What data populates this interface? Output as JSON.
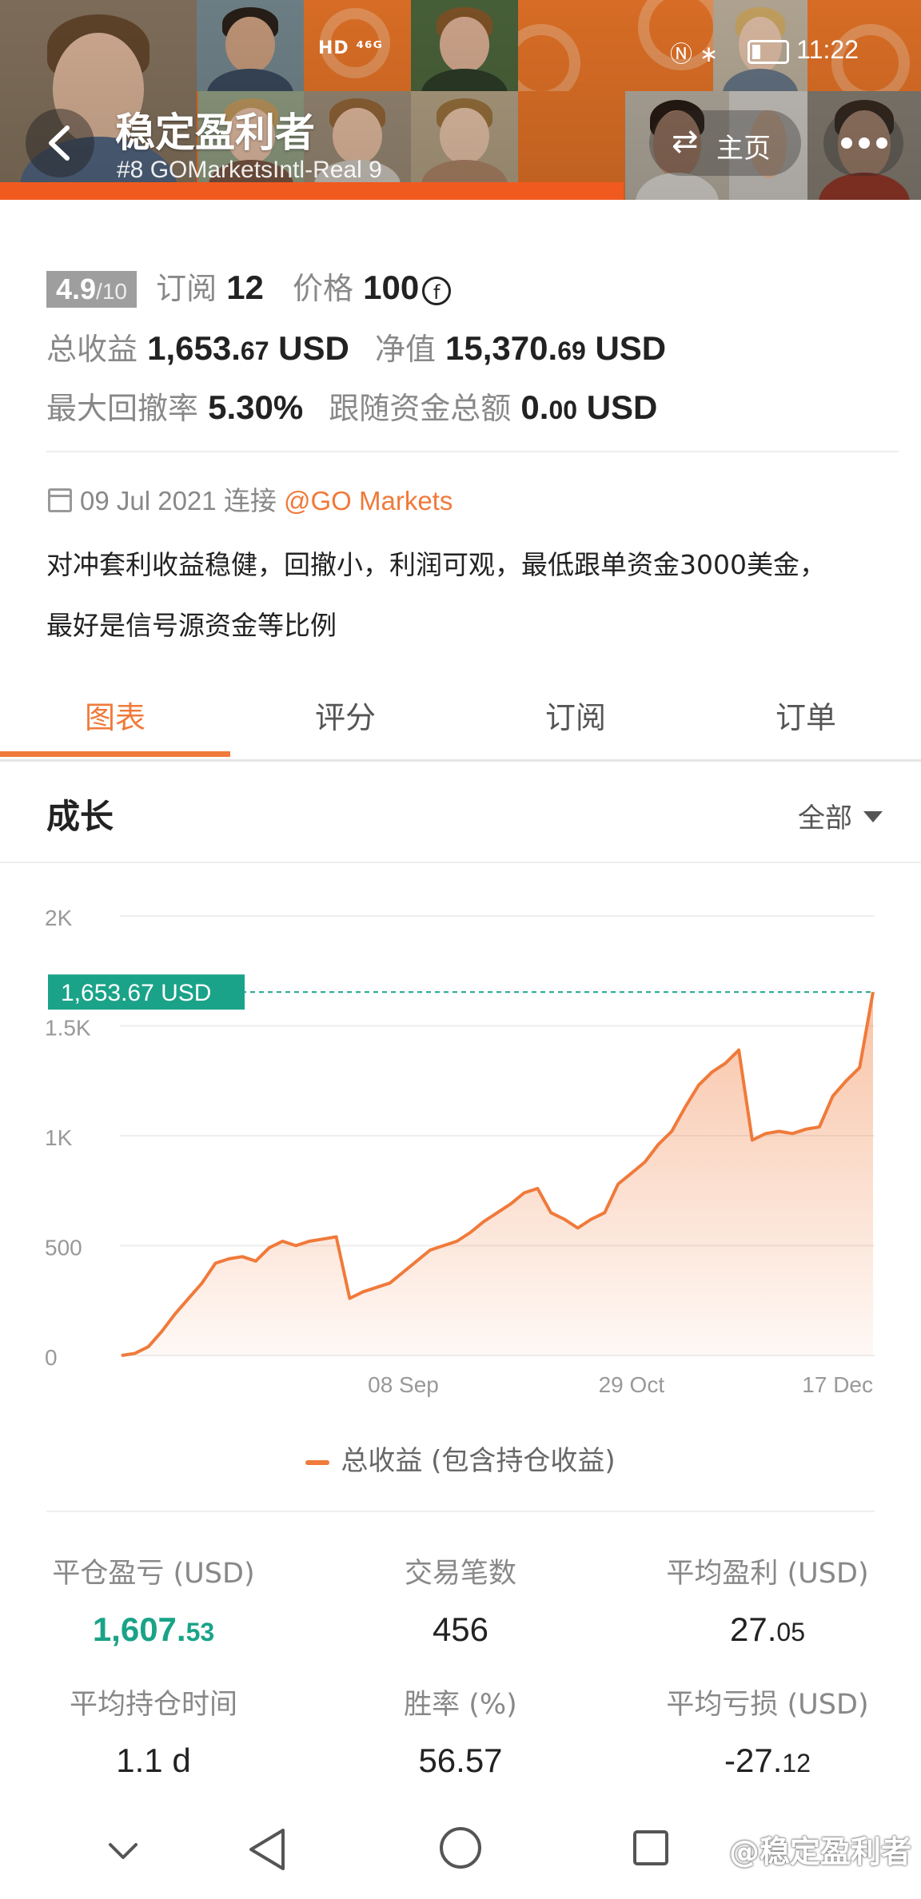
{
  "status_bar": {
    "left_icons": "HD ⁴⁶ᴳ",
    "time": "11:22"
  },
  "header": {
    "title": "稳定盈利者",
    "subtitle": "#8   GOMarketsIntl-Real 9",
    "home_label": "主页",
    "brand_color": "#f47b2a"
  },
  "stats": {
    "rating": "4.9",
    "rating_max": "/10",
    "subscribe_label": "订阅",
    "subscribe_count": "12",
    "price_label": "价格",
    "price_value": "100",
    "price_coin": "f",
    "total_profit_label": "总收益",
    "total_profit_int": "1,653.",
    "total_profit_dec": "67",
    "total_profit_unit": "USD",
    "net_value_label": "净值",
    "net_value_int": "15,370.",
    "net_value_dec": "69",
    "net_value_unit": "USD",
    "max_drawdown_label": "最大回撤率",
    "max_drawdown_value": "5.30%",
    "follow_funds_label": "跟随资金总额",
    "follow_funds_int": "0.",
    "follow_funds_dec": "00",
    "follow_funds_unit": "USD"
  },
  "info": {
    "date": "09 Jul 2021",
    "connect_label": "连接",
    "broker_link": "@GO Markets",
    "description_line1": "对冲套利收益稳健，回撤小，利润可观，最低跟单资金3000美金，",
    "description_line2": "最好是信号源资金等比例"
  },
  "tabs": [
    {
      "label": "图表",
      "active": true
    },
    {
      "label": "评分",
      "active": false
    },
    {
      "label": "订阅",
      "active": false
    },
    {
      "label": "订单",
      "active": false
    }
  ],
  "growth": {
    "title": "成长",
    "filter_label": "全部"
  },
  "chart_data": {
    "type": "area",
    "title": "",
    "xlabel": "",
    "ylabel": "",
    "x_ticks": [
      "08 Sep",
      "29 Oct",
      "17 Dec"
    ],
    "y_ticks": [
      "0",
      "500",
      "1K",
      "1.5K",
      "2K"
    ],
    "ylim": [
      0,
      2000
    ],
    "current_label": "1,653.67 USD",
    "current_value": 1653.67,
    "line_color": "#f07a3a",
    "label_color": "#1aa388",
    "legend_placement": "bottom",
    "grid": true,
    "series": [
      {
        "name": "总收益 (包含持仓收益)",
        "x": [
          "09 Jul",
          "12 Jul",
          "15 Jul",
          "18 Jul",
          "21 Jul",
          "24 Jul",
          "27 Jul",
          "30 Jul",
          "02 Aug",
          "05 Aug",
          "08 Aug",
          "11 Aug",
          "14 Aug",
          "17 Aug",
          "20 Aug",
          "23 Aug",
          "26 Aug",
          "27 Aug",
          "30 Aug",
          "02 Sep",
          "05 Sep",
          "08 Sep",
          "11 Sep",
          "14 Sep",
          "17 Sep",
          "20 Sep",
          "23 Sep",
          "26 Sep",
          "29 Sep",
          "02 Oct",
          "05 Oct",
          "08 Oct",
          "11 Oct",
          "14 Oct",
          "17 Oct",
          "20 Oct",
          "23 Oct",
          "26 Oct",
          "29 Oct",
          "01 Nov",
          "04 Nov",
          "07 Nov",
          "10 Nov",
          "13 Nov",
          "16 Nov",
          "19 Nov",
          "20 Nov",
          "23 Nov",
          "26 Nov",
          "29 Nov",
          "02 Dec",
          "05 Dec",
          "08 Dec",
          "11 Dec",
          "14 Dec",
          "15 Dec",
          "17 Dec"
        ],
        "values": [
          0,
          10,
          40,
          110,
          190,
          260,
          330,
          420,
          440,
          450,
          430,
          490,
          520,
          500,
          520,
          530,
          540,
          260,
          290,
          310,
          330,
          380,
          430,
          480,
          500,
          520,
          560,
          610,
          650,
          690,
          740,
          760,
          650,
          620,
          580,
          620,
          650,
          780,
          830,
          880,
          960,
          1020,
          1130,
          1230,
          1290,
          1330,
          1390,
          980,
          1010,
          1020,
          1010,
          1030,
          1040,
          1180,
          1250,
          1310,
          1653.67
        ]
      }
    ]
  },
  "metrics": [
    {
      "label": "平仓盈亏 (USD)",
      "int": "1,607.",
      "dec": "53",
      "green": true
    },
    {
      "label": "交易笔数",
      "int": "456",
      "dec": "",
      "green": false
    },
    {
      "label": "平均盈利 (USD)",
      "int": "27.",
      "dec": "05",
      "green": false
    },
    {
      "label": "平均持仓时间",
      "int": "1.1 d",
      "dec": "",
      "green": false
    },
    {
      "label": "胜率 (%)",
      "int": "56.57",
      "dec": "",
      "green": false
    },
    {
      "label": "平均亏损 (USD)",
      "int": "-27.",
      "dec": "12",
      "green": false
    }
  ],
  "watermark": "@稳定盈利者"
}
